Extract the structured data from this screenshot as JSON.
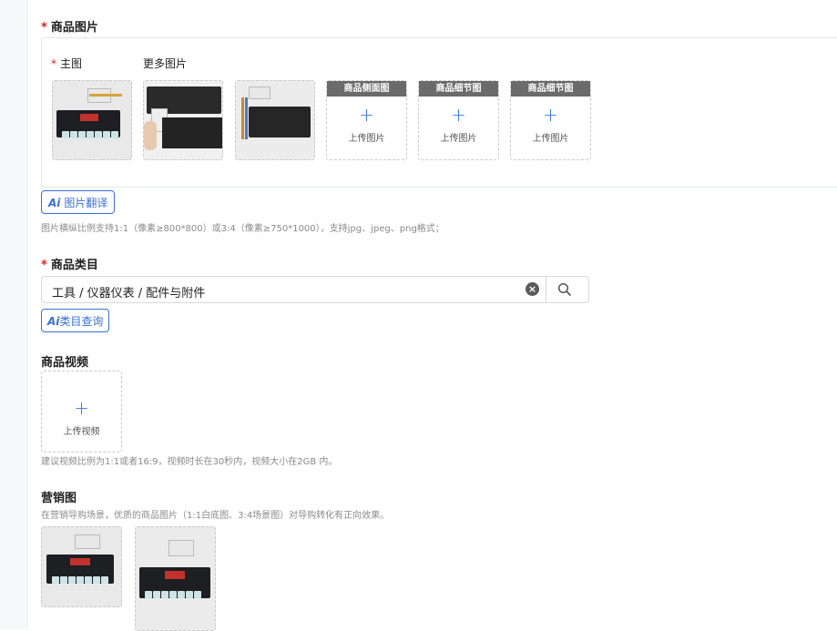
{
  "product_images": {
    "title": "商品图片",
    "main_label": "主图",
    "more_label": "更多图片",
    "slots": [
      {
        "header": "商品侧面图",
        "label": "上传图片"
      },
      {
        "header": "商品细节图",
        "label": "上传图片"
      },
      {
        "header": "商品细节图",
        "label": "上传图片"
      }
    ],
    "ai_button": "图片翻译",
    "hint": "图片横纵比例支持1:1（像素≥800*800）或3:4（像素≥750*1000），支持jpg、jpeg、png格式；"
  },
  "category": {
    "title": "商品类目",
    "value": "工具 / 仪器仪表 / 配件与附件",
    "ai_button": "类目查询"
  },
  "video": {
    "title": "商品视频",
    "upload_label": "上传视频",
    "hint": "建议视频比例为1:1或者16:9，视频时长在30秒内，视频大小在2GB 内。"
  },
  "marketing": {
    "title": "营销图",
    "hint": "在营销导购场景，优质的商品图片（1:1白底图、3:4场景图）对导购转化有正向效果。"
  },
  "ai_badge": "Ai",
  "plus_symbol": "+",
  "colors": {
    "accent": "#3a6fd6",
    "required": "#e02020",
    "slot_header": "#6b6b6b"
  }
}
